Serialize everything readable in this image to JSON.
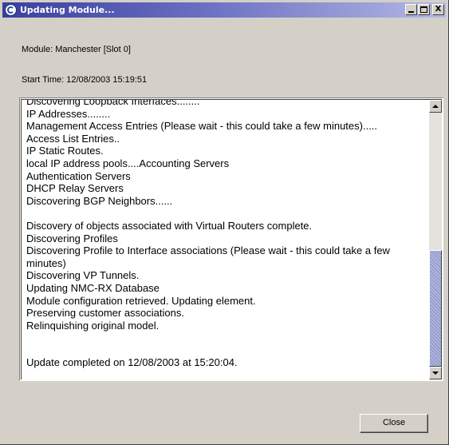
{
  "window": {
    "title": "Updating Module...",
    "controls": {
      "minimize": "_",
      "maximize": "□",
      "close": "X"
    }
  },
  "info": {
    "module": "Module:  Manchester [Slot 0]",
    "start_time": "Start Time: 12/08/2003 15:19:51"
  },
  "log": {
    "lines": [
      "Discovering Loopback Interfaces........",
      "IP Addresses........",
      "Management Access Entries (Please wait - this could take a few minutes).....",
      "Access List Entries..",
      "IP Static Routes.",
      "local IP address pools....Accounting Servers",
      "Authentication Servers",
      "DHCP Relay Servers",
      "Discovering BGP Neighbors......",
      "",
      "Discovery of objects associated with Virtual Routers complete.",
      "Discovering Profiles",
      "Discovering Profile to Interface associations (Please wait - this could take a few minutes)",
      "Discovering VP Tunnels.",
      "Updating NMC-RX Database",
      "Module configuration retrieved. Updating element.",
      "Preserving customer associations.",
      "Relinquishing original model.",
      "",
      "",
      "Update completed on 12/08/2003 at 15:20:04."
    ],
    "scroll": {
      "thumb_start": 0.54,
      "thumb_end": 1.0
    }
  },
  "buttons": {
    "close_label": "Close"
  },
  "colors": {
    "title_gradient_start": "#3a3f9e",
    "title_gradient_end": "#b4b8e4",
    "window_bg": "#d4d0c8",
    "scroll_thumb": "#aeb4dc"
  },
  "icons": {
    "title": "app-globe-icon",
    "scroll_up": "arrow-up-icon",
    "scroll_down": "arrow-down-icon"
  }
}
